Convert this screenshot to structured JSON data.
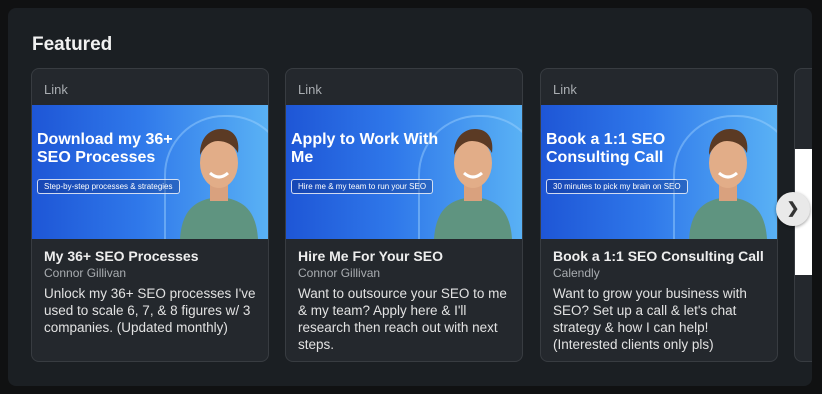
{
  "section": {
    "title": "Featured"
  },
  "cards": [
    {
      "type": "Link",
      "thumb_headline": "Download my 36+ SEO Processes",
      "thumb_pill": "Step-by-step processes & strategies",
      "title": "My 36+ SEO Processes",
      "author": "Connor Gillivan",
      "description": "Unlock my 36+ SEO processes I've used to scale 6, 7, & 8 figures w/ 3 companies. (Updated monthly)"
    },
    {
      "type": "Link",
      "thumb_headline": "Apply to Work With Me",
      "thumb_pill": "Hire me & my team to run your SEO",
      "title": "Hire Me For Your SEO",
      "author": "Connor Gillivan",
      "description": "Want to outsource your SEO to me & my team? Apply here & I'll research then reach out with next steps."
    },
    {
      "type": "Link",
      "thumb_headline": "Book a 1:1 SEO Consulting Call",
      "thumb_pill": "30 minutes to pick my brain on SEO",
      "title": "Book a 1:1 SEO Consulting Call",
      "author": "Calendly",
      "description": "Want to grow your business with SEO? Set up a call & let's chat strategy & how I can help! (Interested clients only pls)"
    }
  ],
  "next_button": {
    "icon": "chevron-right-icon",
    "glyph": "❯"
  },
  "colors": {
    "panel": "#1b1f23",
    "card": "#24282d",
    "thumb_start": "#1e56d6",
    "thumb_end": "#5ab2f5"
  }
}
